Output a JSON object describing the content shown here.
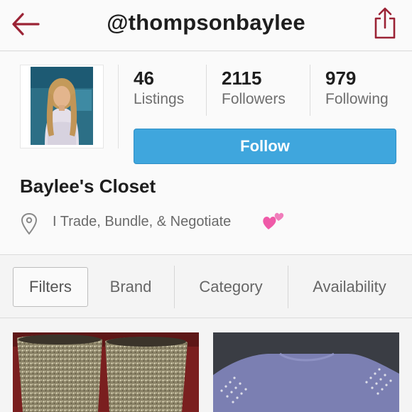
{
  "header": {
    "username": "@thompsonbaylee",
    "back_icon": "back-arrow-icon",
    "share_icon": "share-icon",
    "accent_color": "#9b2335"
  },
  "profile": {
    "avatar_icon": "profile-photo",
    "stats": [
      {
        "value": "46",
        "label": "Listings"
      },
      {
        "value": "2115",
        "label": "Followers"
      },
      {
        "value": "979",
        "label": "Following"
      }
    ],
    "follow_label": "Follow",
    "follow_color": "#3fa6dd",
    "closet_name": "Baylee's Closet",
    "bio": "I Trade, Bundle, & Negotiate",
    "location_icon": "location-pin-icon",
    "bio_emoji_icon": "two-hearts-icon"
  },
  "filters": {
    "filter_button": "Filters",
    "tabs": [
      "Brand",
      "Category",
      "Availability"
    ]
  },
  "listings": [
    {
      "image": "glitter-boots-photo"
    },
    {
      "image": "studded-sweater-photo"
    }
  ]
}
